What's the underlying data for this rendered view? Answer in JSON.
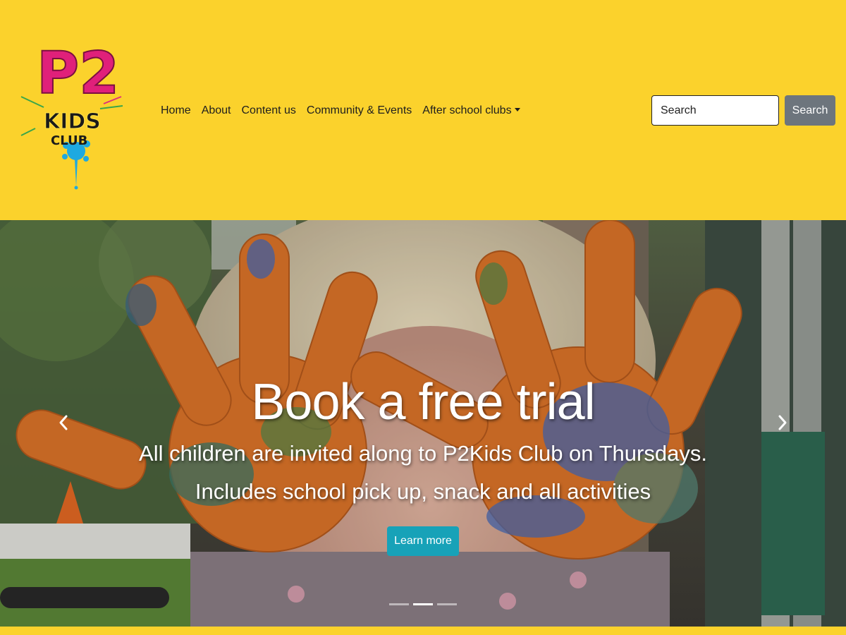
{
  "brand": {
    "logo_text_top": "P2",
    "logo_text_mid": "KIDS",
    "logo_text_bottom": "CLUB"
  },
  "nav": {
    "items": [
      {
        "label": "Home"
      },
      {
        "label": "About"
      },
      {
        "label": "Content us"
      },
      {
        "label": "Community & Events"
      },
      {
        "label": "After school clubs",
        "dropdown": true
      }
    ]
  },
  "search": {
    "placeholder": "Search",
    "button_label": "Search"
  },
  "carousel": {
    "title": "Book a free trial",
    "line1": "All children are invited along to P2Kids Club on Thursdays.",
    "line2": "Includes school pick up, snack and all activities",
    "button_label": "Learn more",
    "slide_count": 3,
    "active_slide": 2,
    "prev_icon": "chevron-left-icon",
    "next_icon": "chevron-right-icon"
  },
  "colors": {
    "brand_yellow": "#fbd22c",
    "search_button": "#6d757d",
    "cta_button": "#17a2b8"
  }
}
